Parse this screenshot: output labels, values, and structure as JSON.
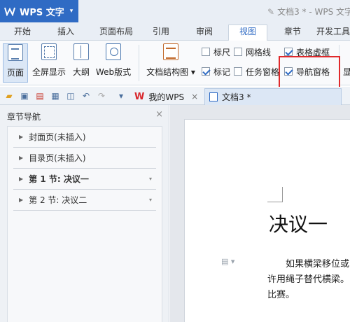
{
  "titlebar": {
    "app_name": "WPS 文字",
    "caret": "▾",
    "doc_title": "文档3 * - WPS 文字"
  },
  "menu": {
    "tabs": [
      "开始",
      "插入",
      "页面布局",
      "引用",
      "审阅",
      "视图",
      "章节",
      "开发工具"
    ],
    "active": "视图"
  },
  "ribbon": {
    "buttons": [
      "页面",
      "全屏显示",
      "大纲",
      "Web版式",
      "文档结构图"
    ],
    "checks": [
      {
        "label": "标尺",
        "checked": false
      },
      {
        "label": "网格线",
        "checked": false
      },
      {
        "label": "表格虚框",
        "checked": true
      },
      {
        "label": "标记",
        "checked": true
      },
      {
        "label": "任务窗格",
        "checked": false
      },
      {
        "label": "导航窗格",
        "checked": true
      }
    ],
    "overflow_label": "显"
  },
  "doctabs": {
    "wps_tab": "我的WPS",
    "doc_tab": "文档3 *",
    "close": "×"
  },
  "nav": {
    "title": "章节导航",
    "close": "×",
    "items": [
      "封面页(未插入)",
      "目录页(未插入)",
      "第 1 节: 决议一",
      "第 2 节: 决议二"
    ]
  },
  "document": {
    "heading": "决议一",
    "lines": [
      "如果横梁移位或",
      "许用绳子替代横梁。",
      "比赛。"
    ]
  },
  "colors": {
    "accent": "#2f6bc4",
    "highlight": "#e0292b",
    "wps_red": "#d8262b"
  }
}
